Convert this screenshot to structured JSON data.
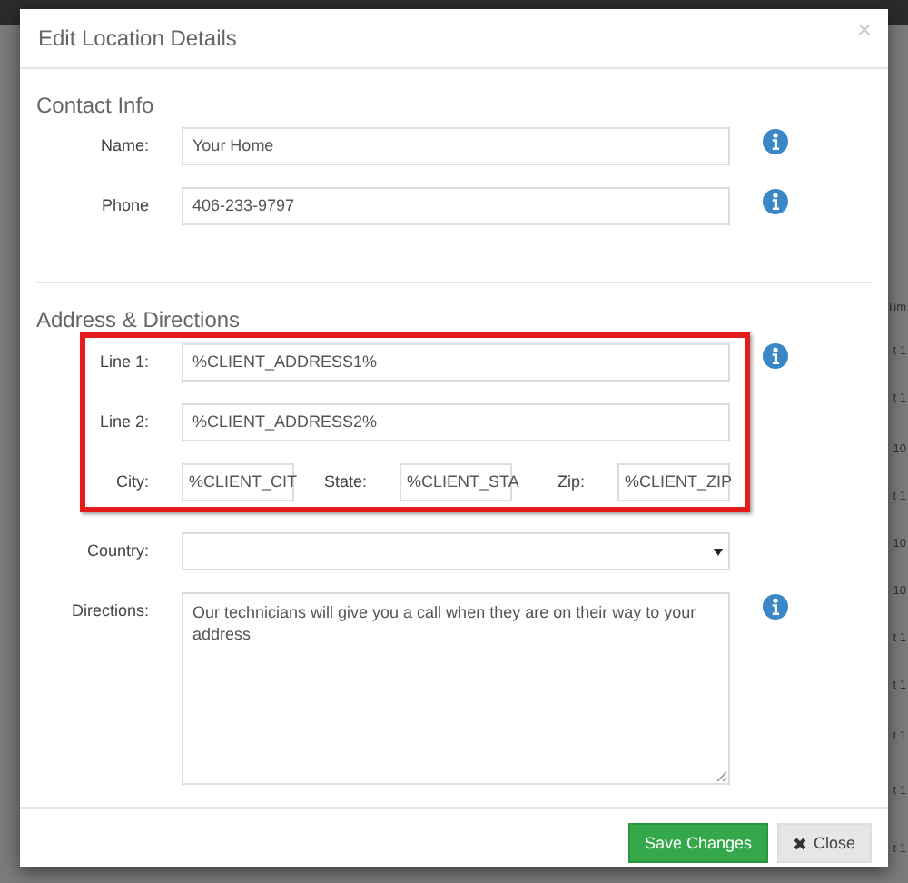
{
  "background": {
    "table_fragments": [
      "Tim",
      "t 1",
      "t 1",
      "10",
      "t 1",
      "10",
      "10",
      "t 1",
      "t 1",
      "t 1",
      "t 1",
      "t 1"
    ]
  },
  "dialog": {
    "title": "Edit Location Details",
    "close": "×",
    "sections": [
      {
        "heading": "Contact Info",
        "rows": [
          {
            "kind": "text",
            "label": "Name:",
            "value": "Your Home",
            "info": true,
            "highlighted": false
          },
          {
            "kind": "text",
            "label": "Phone",
            "value": "406-233-9797",
            "info": true,
            "highlighted": false
          }
        ]
      },
      {
        "heading": "Address & Directions",
        "rows": [
          {
            "kind": "text",
            "label": "Line 1:",
            "value": "%CLIENT_ADDRESS1%",
            "info": true,
            "highlighted": true
          },
          {
            "kind": "text",
            "label": "Line 2:",
            "value": "%CLIENT_ADDRESS2%",
            "info": false,
            "highlighted": true
          },
          {
            "kind": "inline",
            "label": "City:",
            "value": "%CLIENT_CIT",
            "fields": [
              {
                "label": "State:",
                "value": "%CLIENT_STA"
              },
              {
                "label": "Zip:",
                "value": "%CLIENT_ZIP"
              }
            ],
            "info": false,
            "highlighted": true
          },
          {
            "kind": "select",
            "label": "Country:",
            "info": false,
            "highlighted": false
          },
          {
            "kind": "textarea",
            "label": "Directions:",
            "value": "Our technicians will give you a call when they are on their way to your address",
            "info": true,
            "highlighted": false
          }
        ]
      }
    ],
    "buttons": [
      {
        "kind": "primary",
        "label": "Save Changes"
      },
      {
        "kind": "default",
        "label": "Close",
        "icon": true
      }
    ]
  }
}
